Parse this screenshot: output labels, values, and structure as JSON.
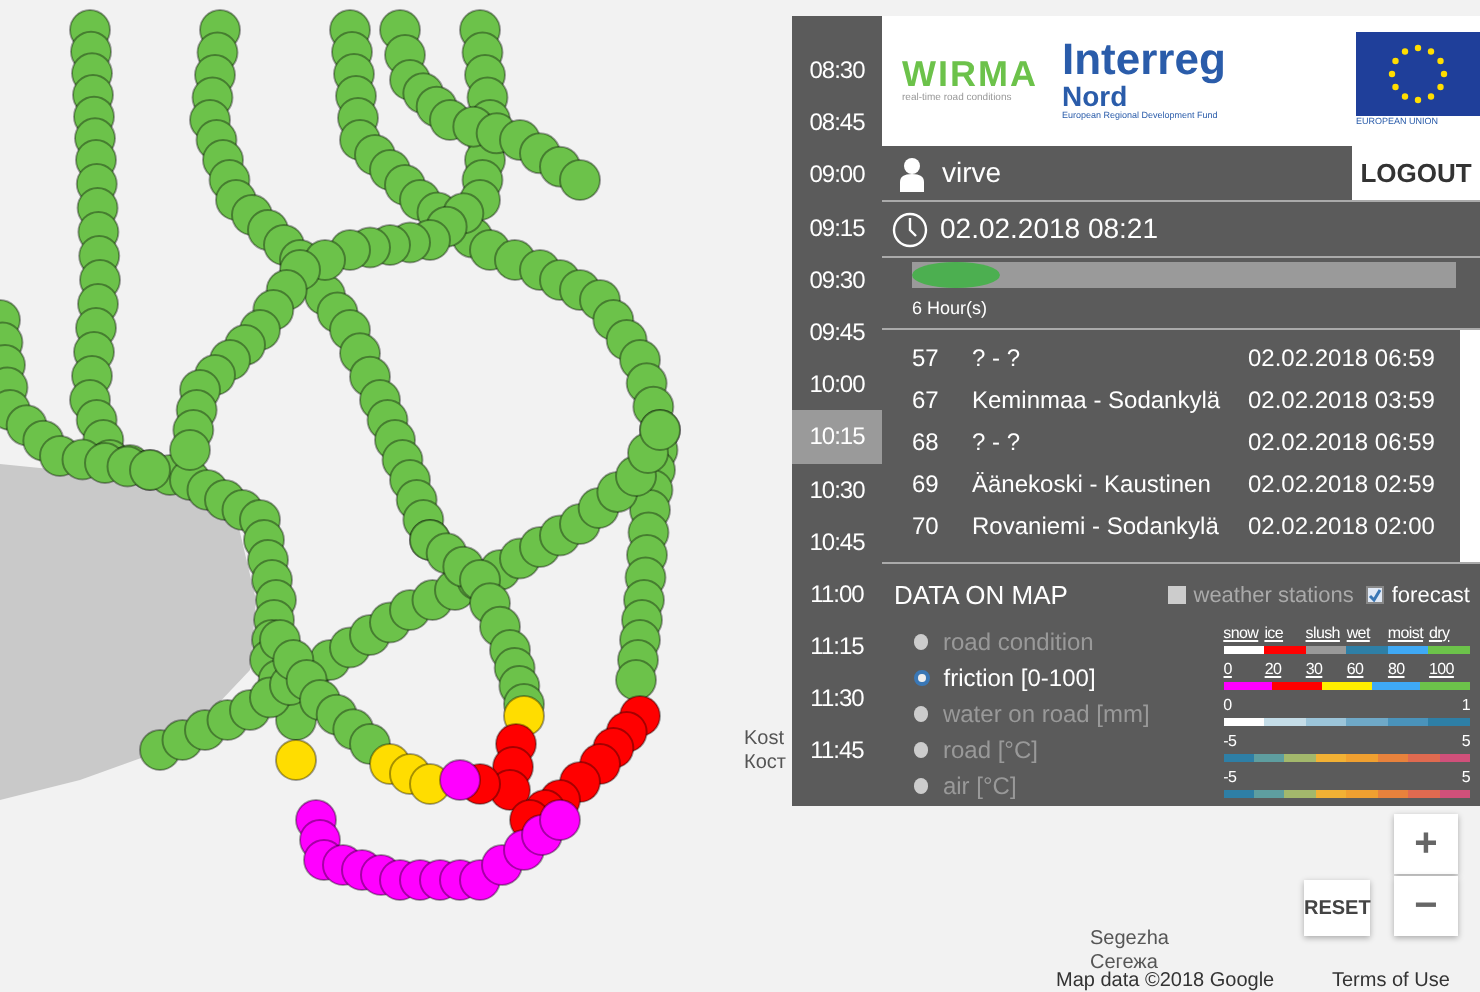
{
  "map": {
    "labels": [
      "Kost",
      "Кост",
      "Segezha",
      "Сегежа"
    ],
    "attribution": "Map data ©2018 Google",
    "terms": "Terms of Use",
    "zoom_in": "+",
    "zoom_out": "−",
    "reset": "RESET"
  },
  "times": [
    {
      "label": "08:30",
      "selected": false
    },
    {
      "label": "08:45",
      "selected": false
    },
    {
      "label": "09:00",
      "selected": false
    },
    {
      "label": "09:15",
      "selected": false
    },
    {
      "label": "09:30",
      "selected": false
    },
    {
      "label": "09:45",
      "selected": false
    },
    {
      "label": "10:00",
      "selected": false
    },
    {
      "label": "10:15",
      "selected": true
    },
    {
      "label": "10:30",
      "selected": false
    },
    {
      "label": "10:45",
      "selected": false
    },
    {
      "label": "11:00",
      "selected": false
    },
    {
      "label": "11:15",
      "selected": false
    },
    {
      "label": "11:30",
      "selected": false
    },
    {
      "label": "11:45",
      "selected": false
    }
  ],
  "logos": {
    "wirma": "WIRMA",
    "wirma_tagline": "real-time road conditions",
    "interreg": "Interreg",
    "nord": "Nord",
    "fund": "European Regional Development Fund",
    "eu": "EUROPEAN UNION"
  },
  "user": {
    "name": "virve",
    "logout": "LOGOUT"
  },
  "datetime": "02.02.2018 08:21",
  "timeline": {
    "level": 0.16,
    "label": "6 Hour(s)"
  },
  "routes": [
    {
      "id": "57",
      "name": "? - ?",
      "time": "02.02.2018 06:59"
    },
    {
      "id": "67",
      "name": "Keminmaa - Sodankylä",
      "time": "02.02.2018 03:59"
    },
    {
      "id": "68",
      "name": "? - ?",
      "time": "02.02.2018 06:59"
    },
    {
      "id": "69",
      "name": "Äänekoski - Kaustinen",
      "time": "02.02.2018 02:59"
    },
    {
      "id": "70",
      "name": "Rovaniemi - Sodankylä",
      "time": "02.02.2018 02:00"
    }
  ],
  "data_on_map": {
    "title": "DATA ON MAP",
    "toggles": [
      {
        "label": "weather stations",
        "checked": false
      },
      {
        "label": "forecast",
        "checked": true
      }
    ],
    "layers": [
      {
        "label": "road condition",
        "selected": false,
        "kind": "segments",
        "ticks": [
          "snow",
          "ice",
          "slush",
          "wet",
          "moist",
          "dry"
        ],
        "segments": [
          {
            "color": "#ffffff"
          },
          {
            "color": "#ff0000"
          },
          {
            "color": "#999999"
          },
          {
            "color": "#2e7fa6"
          },
          {
            "color": "#3fa9f5"
          },
          {
            "color": "#6cc24a"
          }
        ]
      },
      {
        "label": "friction [0-100]",
        "selected": true,
        "kind": "segments",
        "ticks": [
          "0",
          "20",
          "30",
          "60",
          "80",
          "100"
        ],
        "segments": [
          {
            "color": "#ff00ff"
          },
          {
            "color": "#ff0000"
          },
          {
            "color": "#ffee00"
          },
          {
            "color": "#3fa9f5"
          },
          {
            "color": "#6cc24a"
          }
        ]
      },
      {
        "label": "water on road [mm]",
        "selected": false,
        "kind": "gradient",
        "ticks": [
          "0",
          "1"
        ],
        "segments": [
          {
            "color": "#ffffff"
          },
          {
            "color": "#c5dde8"
          },
          {
            "color": "#9cc5da"
          },
          {
            "color": "#6fa9c8"
          },
          {
            "color": "#4a93bb"
          },
          {
            "color": "#2e7fa6"
          }
        ]
      },
      {
        "label": "road [°C]",
        "selected": false,
        "kind": "gradient",
        "ticks": [
          "-5",
          "5"
        ],
        "segments": [
          {
            "color": "#2e7fa6"
          },
          {
            "color": "#5e9ea0"
          },
          {
            "color": "#a3b86c"
          },
          {
            "color": "#f2b134"
          },
          {
            "color": "#f0a030"
          },
          {
            "color": "#e8823c"
          },
          {
            "color": "#e06a50"
          },
          {
            "color": "#d0507a"
          }
        ]
      },
      {
        "label": "air [°C]",
        "selected": false,
        "kind": "gradient",
        "ticks": [
          "-5",
          "5"
        ],
        "segments": [
          {
            "color": "#2e7fa6"
          },
          {
            "color": "#5e9ea0"
          },
          {
            "color": "#a3b86c"
          },
          {
            "color": "#f2b134"
          },
          {
            "color": "#f0a030"
          },
          {
            "color": "#e8823c"
          },
          {
            "color": "#e06a50"
          },
          {
            "color": "#d0507a"
          }
        ]
      }
    ]
  }
}
